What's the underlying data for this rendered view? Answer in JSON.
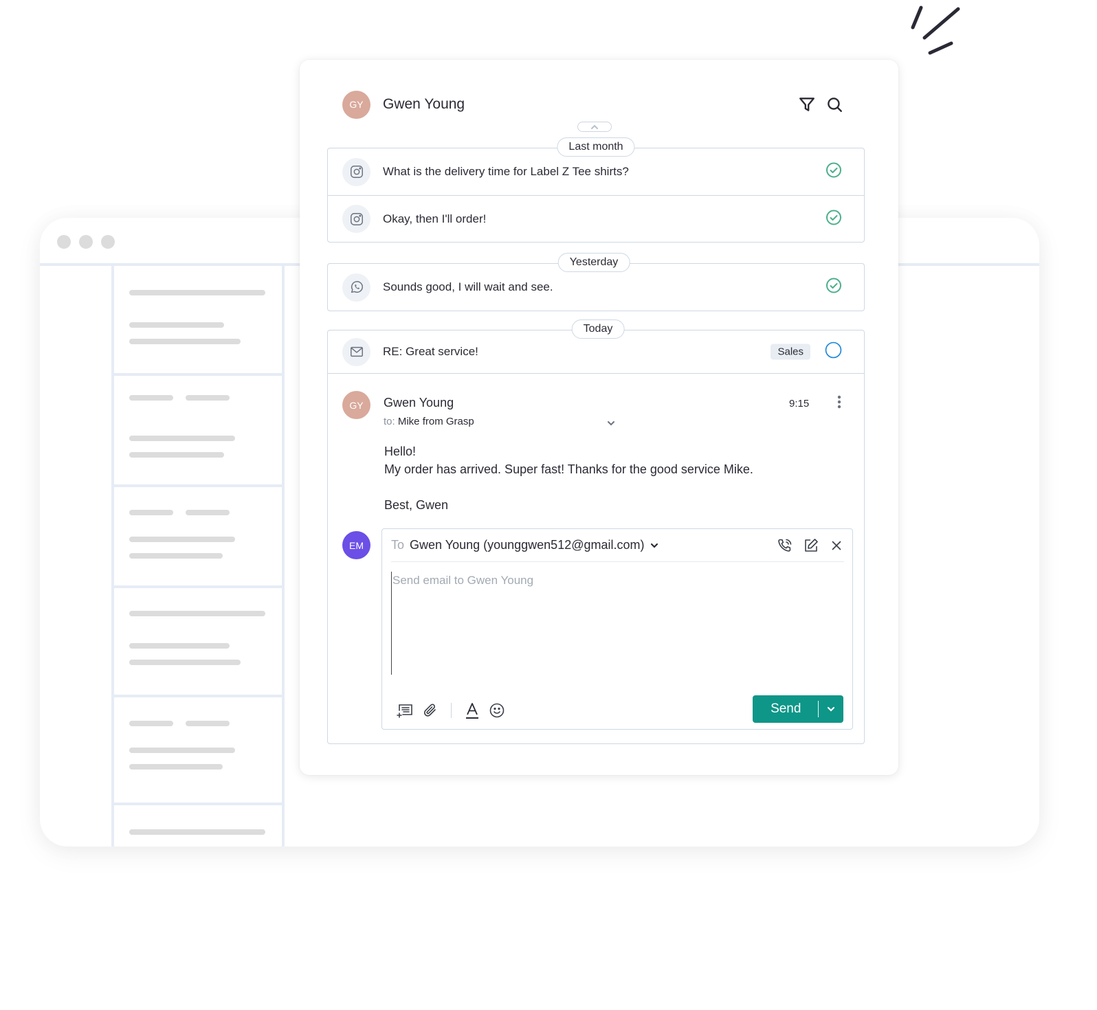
{
  "header": {
    "avatar_initials": "GY",
    "contact_name": "Gwen Young",
    "filter_icon": "filter-icon",
    "search_icon": "search-icon"
  },
  "timeline": [
    {
      "date_label": "Last month",
      "messages": [
        {
          "channel": "instagram",
          "text": "What is the delivery time for Label Z Tee shirts?",
          "status": "resolved"
        },
        {
          "channel": "instagram",
          "text": "Okay, then I'll order!",
          "status": "resolved"
        }
      ]
    },
    {
      "date_label": "Yesterday",
      "messages": [
        {
          "channel": "whatsapp",
          "text": "Sounds good, I will wait and see.",
          "status": "resolved"
        }
      ]
    },
    {
      "date_label": "Today",
      "messages": [
        {
          "channel": "email",
          "text": "RE: Great service!",
          "tag": "Sales",
          "status": "open"
        }
      ]
    }
  ],
  "email": {
    "avatar_initials": "GY",
    "from": "Gwen Young",
    "to_label": "to:",
    "to": "Mike from Grasp",
    "time": "9:15",
    "body": [
      "Hello!",
      "My order has arrived. Super fast! Thanks for the good service Mike.",
      "",
      "Best, Gwen"
    ]
  },
  "composer": {
    "avatar_initials": "EM",
    "to_label": "To",
    "recipient": "Gwen Young (younggwen512@gmail.com)",
    "placeholder": "Send email to Gwen Young",
    "send_label": "Send"
  },
  "colors": {
    "accent": "#0e9688",
    "resolved": "#4caf8a",
    "open": "#1e88d6",
    "avatar_gy": "#d9a99b",
    "avatar_em": "#6b4fe6"
  }
}
